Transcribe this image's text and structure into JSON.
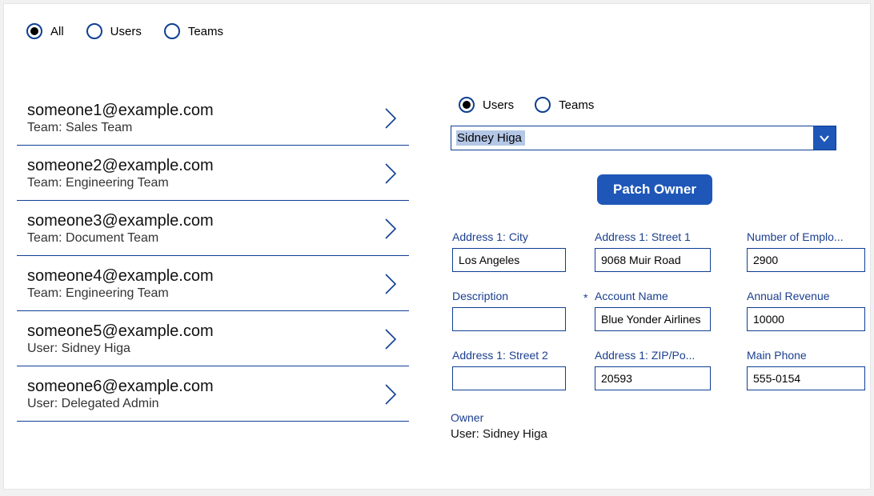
{
  "topFilters": [
    {
      "label": "All",
      "selected": true
    },
    {
      "label": "Users",
      "selected": false
    },
    {
      "label": "Teams",
      "selected": false
    }
  ],
  "list": [
    {
      "primary": "someone1@example.com",
      "secondary": "Team: Sales Team"
    },
    {
      "primary": "someone2@example.com",
      "secondary": "Team: Engineering Team"
    },
    {
      "primary": "someone3@example.com",
      "secondary": "Team: Document Team"
    },
    {
      "primary": "someone4@example.com",
      "secondary": "Team: Engineering Team"
    },
    {
      "primary": "someone5@example.com",
      "secondary": "User: Sidney Higa"
    },
    {
      "primary": "someone6@example.com",
      "secondary": "User: Delegated Admin"
    }
  ],
  "ownerTypes": [
    {
      "label": "Users",
      "selected": true
    },
    {
      "label": "Teams",
      "selected": false
    }
  ],
  "ownerSelect": {
    "value": "Sidney Higa"
  },
  "patchButton": "Patch Owner",
  "fields": {
    "city": {
      "label": "Address 1: City",
      "value": "Los Angeles"
    },
    "street1": {
      "label": "Address 1: Street 1",
      "value": "9068 Muir Road"
    },
    "numemp": {
      "label": "Number of Emplo...",
      "value": "2900"
    },
    "desc": {
      "label": "Description",
      "value": ""
    },
    "acct": {
      "label": "Account Name",
      "value": "Blue Yonder Airlines",
      "required": true
    },
    "revenue": {
      "label": "Annual Revenue",
      "value": "10000"
    },
    "street2": {
      "label": "Address 1: Street 2",
      "value": ""
    },
    "zip": {
      "label": "Address 1: ZIP/Po...",
      "value": "20593"
    },
    "phone": {
      "label": "Main Phone",
      "value": "555-0154"
    }
  },
  "ownerInfo": {
    "label": "Owner",
    "value": "User: Sidney Higa"
  }
}
